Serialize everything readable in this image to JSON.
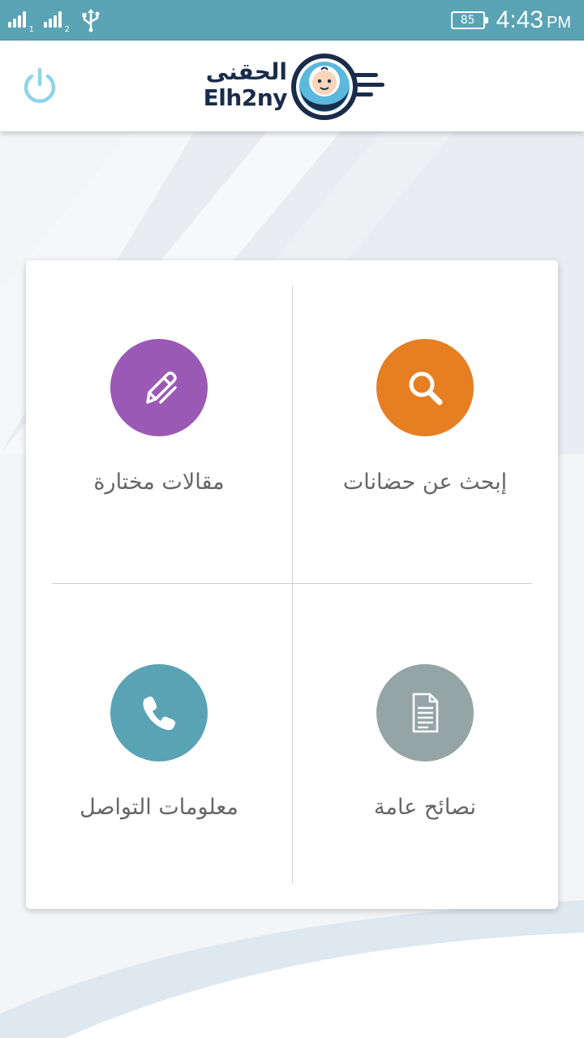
{
  "status_bar": {
    "sim1_label": "1",
    "sim2_label": "2",
    "battery_level": "85",
    "time": "4:43",
    "ampm": "PM"
  },
  "header": {
    "logo_arabic": "الحقنى",
    "logo_latin": "Elh2ny"
  },
  "menu": {
    "articles": {
      "label": "مقالات مختارة",
      "color": "#9b59b6",
      "icon": "pencil-icon"
    },
    "search": {
      "label": "إبحث عن حضانات",
      "color": "#e67e22",
      "icon": "search-icon"
    },
    "contact": {
      "label": "معلومات التواصل",
      "color": "#5aa3b5",
      "icon": "phone-icon"
    },
    "tips": {
      "label": "نصائح عامة",
      "color": "#95a5a6",
      "icon": "document-icon"
    }
  },
  "colors": {
    "status_bar": "#5aa3b5",
    "power_icon": "#8ed4e8",
    "logo_navy": "#1a2c4a",
    "logo_blue": "#5ab9dc"
  }
}
